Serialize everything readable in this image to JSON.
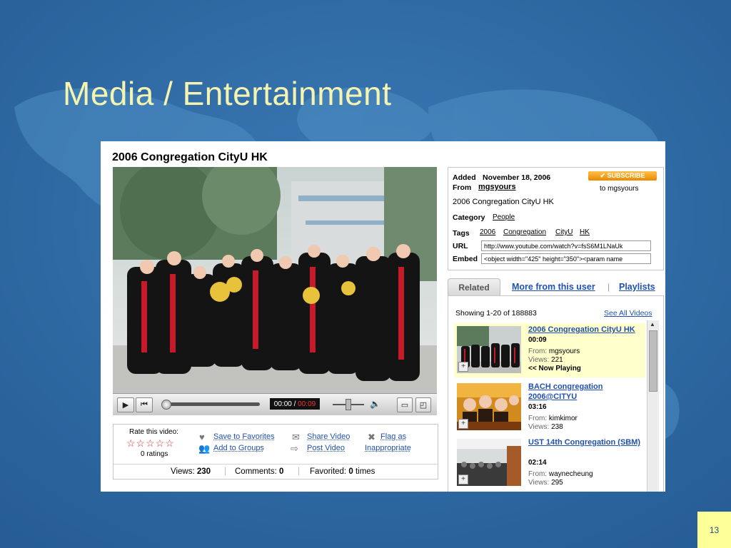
{
  "slide": {
    "title": "Media / Entertainment",
    "page_number": "13"
  },
  "colors": {
    "background": "#2f6aa3",
    "title": "#f4f4b0",
    "link": "#2050b0",
    "subscribe": "#f0a020"
  },
  "video": {
    "title": "2006 Congregation CityU HK",
    "time_current": "00:00",
    "time_separator": " / ",
    "time_duration": "00:09",
    "progress": 0,
    "controls": {
      "play_icon": "play-icon",
      "previous_icon": "skip-back-icon",
      "volume_icon": "speaker-icon",
      "normal_size_icon": "screen-icon",
      "fullscreen_icon": "fullscreen-icon"
    }
  },
  "rating": {
    "label": "Rate this video:",
    "stars": "☆☆☆☆☆",
    "ratings_text": "0 ratings"
  },
  "actions": {
    "save_to_favorites": "Save to Favorites",
    "add_to_groups": "Add to Groups",
    "share_video": "Share Video",
    "post_video": "Post Video",
    "flag_as": "Flag as",
    "inappropriate": "Inappropriate"
  },
  "stats": {
    "views_label": "Views:",
    "views_value": "230",
    "comments_label": "Comments:",
    "comments_value": "0",
    "favorited_label": "Favorited:",
    "favorited_value": "0",
    "favorited_suffix": "times"
  },
  "info": {
    "added_label": "Added",
    "added_value": "November 18, 2006",
    "from_label": "From",
    "from_value": "mgsyours",
    "subscribe_label": "✔ SUBSCRIBE",
    "subscribe_to": "to mgsyours",
    "description": "2006 Congregation CityU HK",
    "category_label": "Category",
    "category_value": "People",
    "tags_label": "Tags",
    "tags": [
      "2006",
      "Congregation",
      "CityU",
      "HK"
    ],
    "url_label": "URL",
    "url_value": "http://www.youtube.com/watch?v=fsS6M1LNaUk",
    "embed_label": "Embed",
    "embed_value": "<object width=\"425\" height=\"350\"><param name"
  },
  "tabs": {
    "related": "Related",
    "more_from_user": "More from this user",
    "separator": "|",
    "playlists": "Playlists"
  },
  "related": {
    "showing": "Showing 1-20 of 188883",
    "see_all": "See All Videos",
    "from_label": "From:",
    "views_label": "Views:",
    "items": [
      {
        "title": "2006 Congregation CityU HK",
        "duration": "00:09",
        "from": "mgsyours",
        "views": "221",
        "now_playing": "<< Now Playing"
      },
      {
        "title": "BACH congregation 2006@CITYU",
        "duration": "03:16",
        "from": "kimkimor",
        "views": "238"
      },
      {
        "title": "UST 14th Congregation (SBM)",
        "duration": "02:14",
        "from": "waynecheung",
        "views": "295"
      }
    ]
  }
}
